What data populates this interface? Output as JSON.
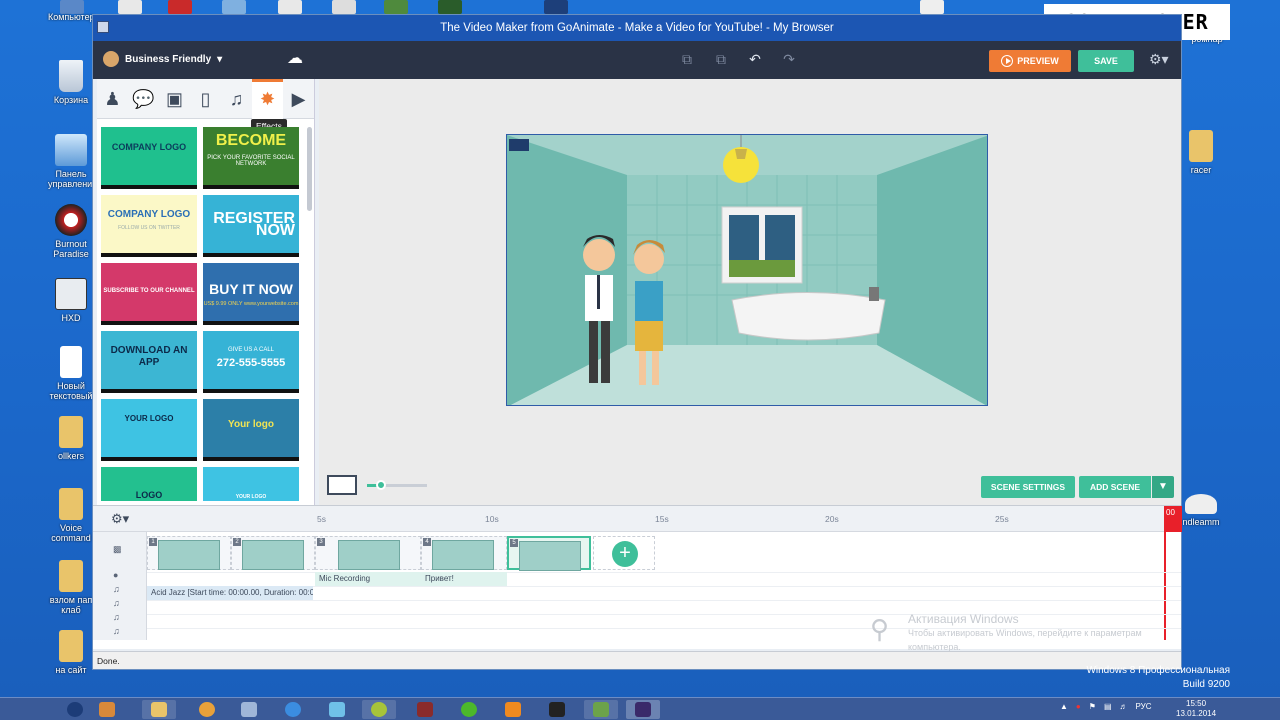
{
  "overlay_label": "SOLAR POWER",
  "window": {
    "title": "The Video Maker from GoAnimate - Make a Video for YouTube! - My Browser"
  },
  "desktop_icons": [
    {
      "label": "Компьютер"
    },
    {
      "label": "Корзина"
    },
    {
      "label": "Панель управления"
    },
    {
      "label": "Burnout Paradise"
    },
    {
      "label": "HXD"
    },
    {
      "label": "Новый текстовый"
    },
    {
      "label": "ollkers"
    },
    {
      "label": "Voice command"
    },
    {
      "label": "взлом пап клаб"
    },
    {
      "label": "на сайт"
    }
  ],
  "right_desktop_icons": [
    {
      "label": "racer"
    },
    {
      "label": "ndleamm"
    },
    {
      "label": "ромнар"
    }
  ],
  "app": {
    "theme": "Business Friendly",
    "tooltip": "Effects",
    "preview_label": "PREVIEW",
    "save_label": "SAVE",
    "category_tabs": [
      {
        "icon": "character-icon"
      },
      {
        "icon": "speech-bubble-icon"
      },
      {
        "icon": "image-icon"
      },
      {
        "icon": "device-icon"
      },
      {
        "icon": "music-icon"
      },
      {
        "icon": "effects-wand-icon"
      },
      {
        "icon": "video-icon"
      }
    ],
    "tiles": [
      {
        "title": "COMPANY LOGO",
        "sub": "",
        "bg": "#1fc08e",
        "fg": "#0b3d5c"
      },
      {
        "title": "BECOME",
        "sub": "PICK YOUR FAVORITE SOCIAL NETWORK",
        "bg": "#3a7f2f",
        "fg": "#f0f04a"
      },
      {
        "title": "COMPANY LOGO",
        "sub": "FOLLOW US ON TWITTER",
        "bg": "#fbf8c7",
        "fg": "#2a6fb6"
      },
      {
        "title": "REGISTER NOW",
        "sub": "",
        "bg": "#36b3d6",
        "fg": "#ffffff"
      },
      {
        "title": "SUBSCRIBE TO OUR CHANNEL",
        "sub": "",
        "bg": "#d4396a",
        "fg": "#ffffff"
      },
      {
        "title": "BUY IT NOW",
        "sub": "US$ 9.99 ONLY  www.yourwebsite.com",
        "bg": "#2f6fae",
        "fg": "#ffffff"
      },
      {
        "title": "DOWNLOAD AN APP",
        "sub": "",
        "bg": "#3cb6d3",
        "fg": "#0c2a4a"
      },
      {
        "title": "272-555-5555",
        "sub": "GIVE US A CALL",
        "bg": "#36b3d6",
        "fg": "#ffffff"
      },
      {
        "title": "YOUR LOGO",
        "sub": "",
        "bg": "#3ec3e3",
        "fg": "#0c2a4a"
      },
      {
        "title": "Your logo",
        "sub": "",
        "bg": "#2c7fa8",
        "fg": "#f2e552"
      },
      {
        "title": "LOGO",
        "sub": "",
        "bg": "#23c08f",
        "fg": "#0c2a4a"
      },
      {
        "title": "YOUR LOGO",
        "sub": "",
        "bg": "#3ec3e3",
        "fg": "#ffffff"
      }
    ],
    "scene_settings_label": "SCENE SETTINGS",
    "add_scene_label": "ADD SCENE"
  },
  "timeline": {
    "ticks": [
      "5s",
      "10s",
      "15s",
      "20s",
      "25s"
    ],
    "playhead_label": "00",
    "scenes": [
      {
        "num": "1"
      },
      {
        "num": "2"
      },
      {
        "num": "3"
      },
      {
        "num": "4"
      },
      {
        "num": "5"
      }
    ],
    "clips": {
      "mic": "Mic Recording",
      "privet": "Привет!",
      "music": "Acid Jazz [Start time: 00:00.00, Duration: 00:0"
    }
  },
  "status": "Done.",
  "watermark": {
    "title": "Активация Windows",
    "line1": "Чтобы активировать Windows, перейдите к параметрам",
    "line2": "компьютера."
  },
  "build": {
    "edition": "Windows 8 Профессиональная",
    "build": "Build 9200"
  },
  "tray": {
    "lang": "РУС",
    "time": "15:50",
    "date": "13.01.2014"
  },
  "colors": {
    "accent_green": "#3fbf9a",
    "accent_orange": "#ef7b35",
    "header": "#2a3346",
    "playhead": "#e8202a"
  }
}
